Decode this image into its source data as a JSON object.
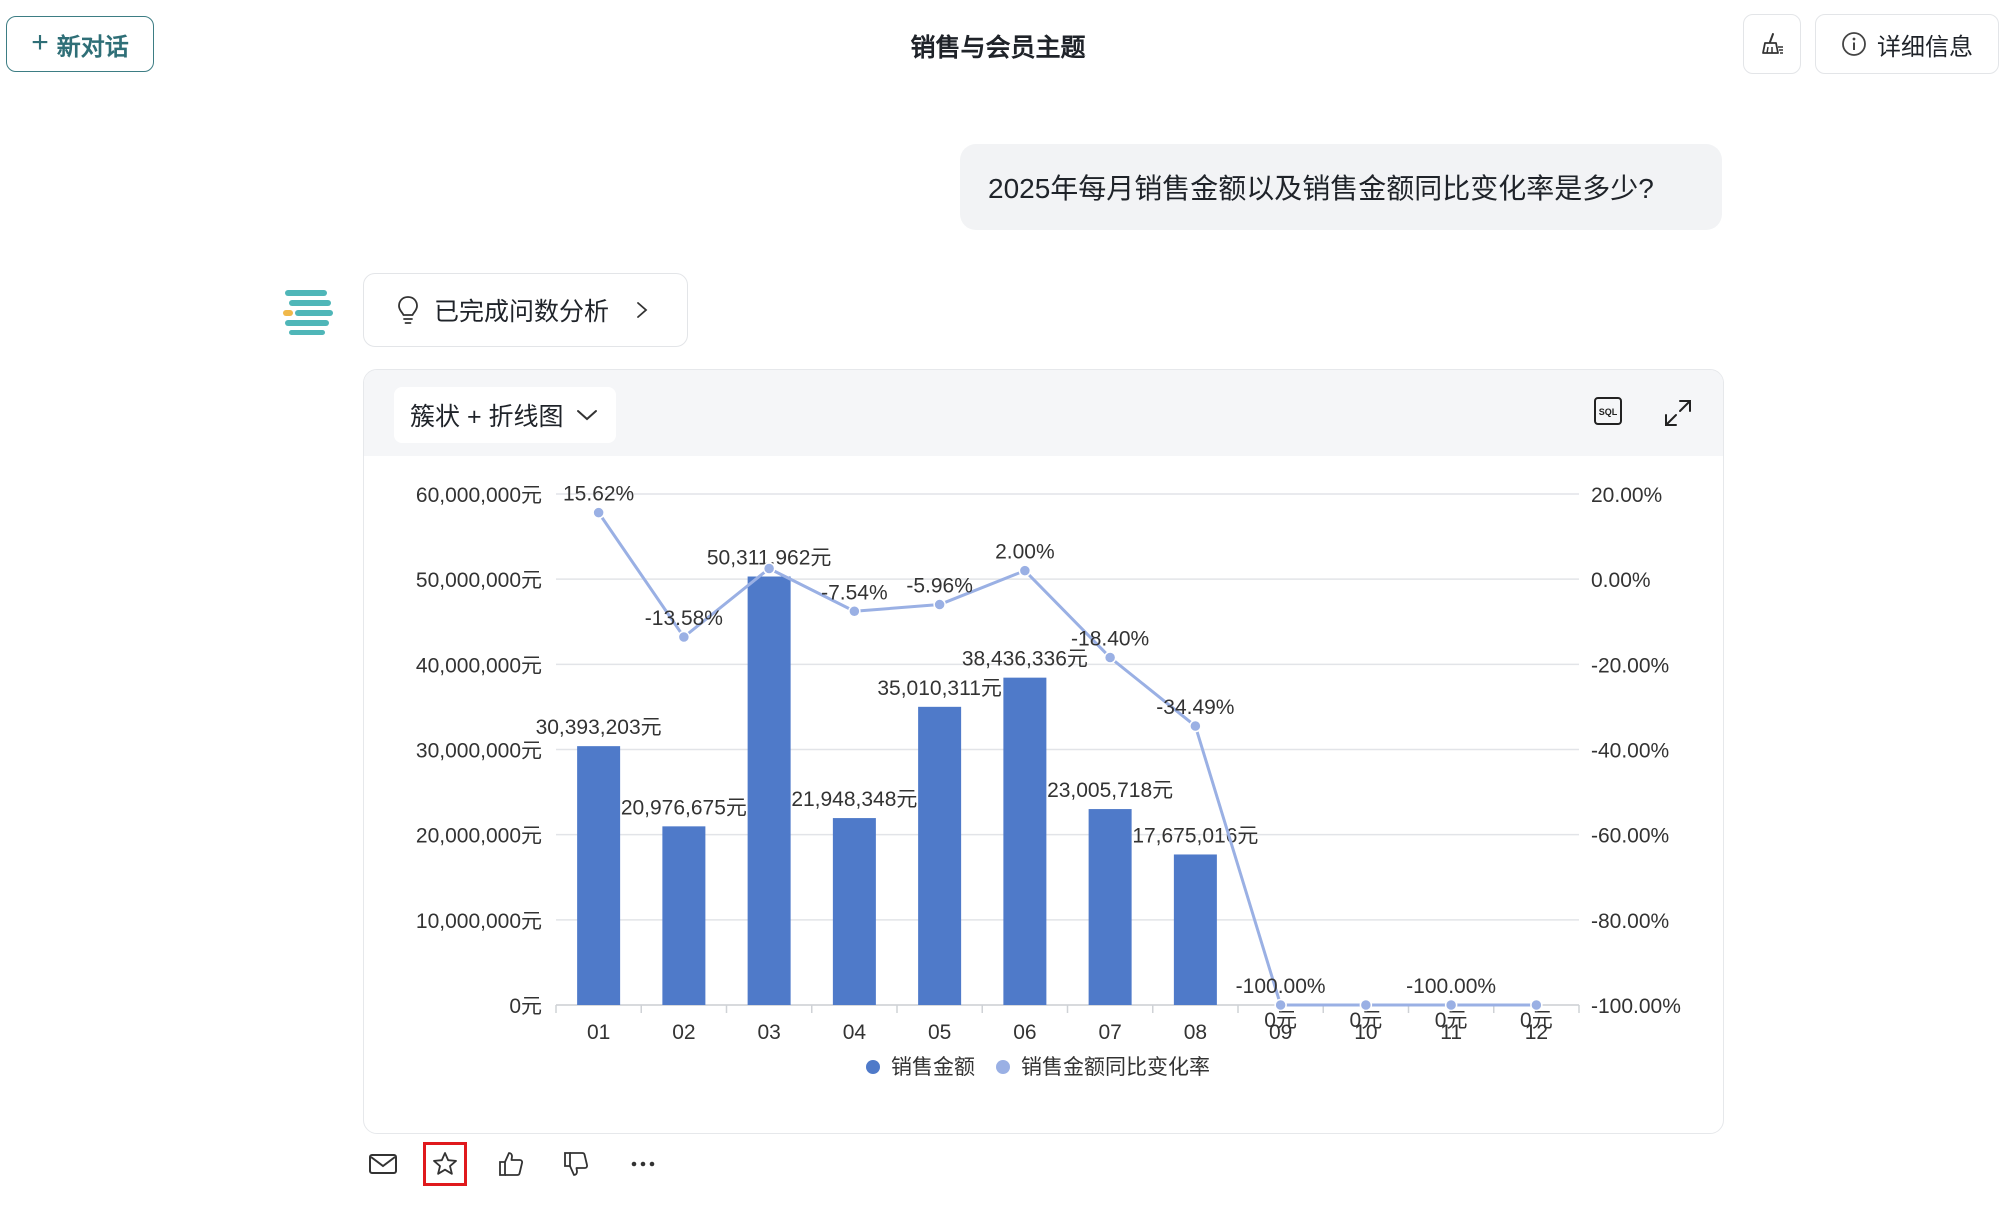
{
  "header": {
    "new_chat_label": "新对话",
    "new_chat_plus": "+",
    "title": "销售与会员主题",
    "details_label": "详细信息"
  },
  "conversation": {
    "user_question": "2025年每月销售金额以及销售金额同比变化率是多少?",
    "analysis_status": "已完成问数分析"
  },
  "chart_toolbar": {
    "chart_type_label": "簇状 + 折线图",
    "sql_icon_text": "SQL"
  },
  "colors": {
    "bar": "#4f7ac9",
    "line": "#9ab0e4",
    "accent": "#2f6f77",
    "highlight_box": "#e0191d"
  },
  "chart_data": {
    "type": "bar+line",
    "categories": [
      "01",
      "02",
      "03",
      "04",
      "05",
      "06",
      "07",
      "08",
      "09",
      "10",
      "11",
      "12"
    ],
    "series": [
      {
        "name": "销售金额",
        "type": "bar",
        "axis": "left",
        "values": [
          30393203,
          20976675,
          50311962,
          21948348,
          35010311,
          38436336,
          23005718,
          17675016,
          0,
          0,
          0,
          0
        ],
        "labels": [
          "30,393,203元",
          "20,976,675元",
          "50,311,962元",
          "21,948,348元",
          "35,010,311元",
          "38,436,336元",
          "23,005,718元",
          "17,675,016元",
          "0元",
          "0元",
          "0元",
          "0元"
        ]
      },
      {
        "name": "销售金额同比变化率",
        "type": "line",
        "axis": "right",
        "values": [
          15.62,
          -13.58,
          2.5,
          -7.54,
          -5.96,
          2.0,
          -18.4,
          -34.49,
          -100.0,
          -100.0,
          -100.0,
          -100.0
        ],
        "labels": [
          "15.62%",
          "-13.58%",
          "",
          "-7.54%",
          "-5.96%",
          "2.00%",
          "-18.40%",
          "-34.49%",
          "-100.00%",
          "",
          "-100.00%",
          ""
        ]
      }
    ],
    "y_left": {
      "min": 0,
      "max": 60000000,
      "ticks": [
        "60,000,000元",
        "50,000,000元",
        "40,000,000元",
        "30,000,000元",
        "20,000,000元",
        "10,000,000元",
        "0元"
      ]
    },
    "y_right": {
      "min": -100,
      "max": 20,
      "ticks": [
        "20.00%",
        "0.00%",
        "-20.00%",
        "-40.00%",
        "-60.00%",
        "-80.00%",
        "-100.00%"
      ]
    },
    "grid": true,
    "legend": "bottom"
  }
}
